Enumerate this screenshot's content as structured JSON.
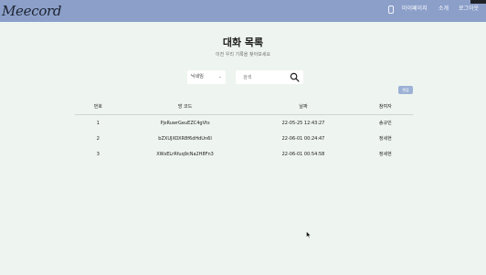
{
  "header": {
    "logo": "Meecord",
    "nav": {
      "mypage": "마이페이지",
      "about": "소개",
      "logout": "로그아웃"
    }
  },
  "main": {
    "title": "대화 목록",
    "subtitle": "이전 우리 기록을 찾아보세요",
    "search": {
      "select_value": "닉네임",
      "placeholder": "검색"
    },
    "edit_label": "편집"
  },
  "table": {
    "columns": [
      "번호",
      "방 코드",
      "날짜",
      "참여자"
    ],
    "rows": [
      {
        "num": "1",
        "code": "PjsRuwrGeuEZC4gVts",
        "date": "22-05-25 12:43:27",
        "owner": "송규민"
      },
      {
        "num": "2",
        "code": "bZXUJXOXR8f6dHdUn6I",
        "date": "22-06-01 00:24:47",
        "owner": "정세현"
      },
      {
        "num": "3",
        "code": "XWsELrRfuq9cNa2H8Fn3",
        "date": "22-06-01 00:54:58",
        "owner": "정세현"
      }
    ]
  },
  "colors": {
    "header_bg": "#8b9fc9",
    "page_bg": "#eef4ef",
    "edit_button_bg": "#9db1d6"
  }
}
